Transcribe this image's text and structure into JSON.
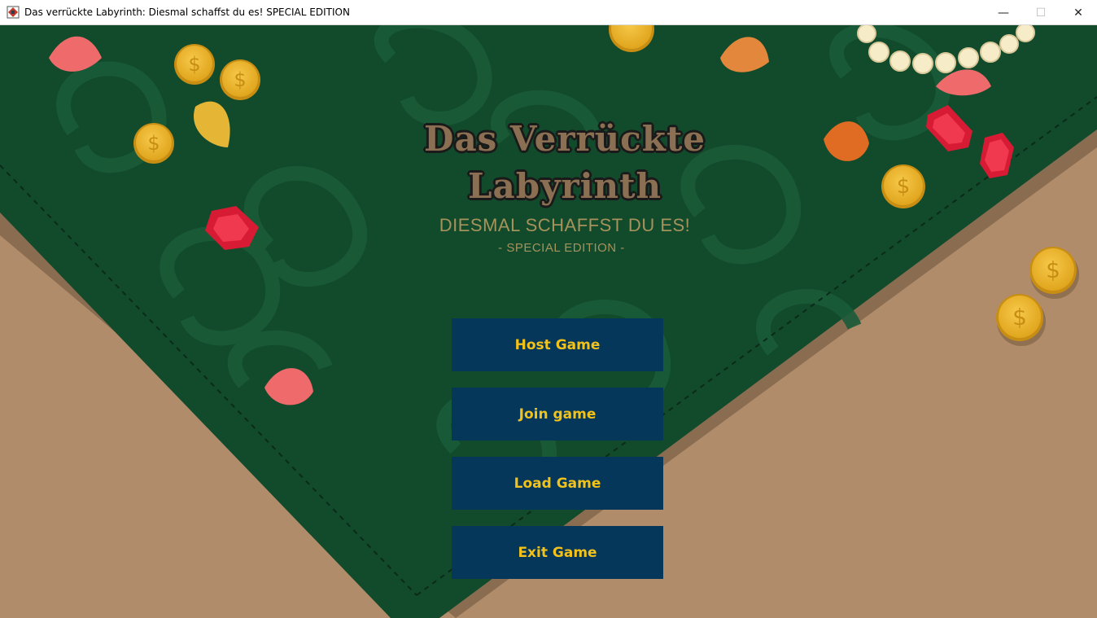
{
  "window": {
    "title": "Das verrückte Labyrinth: Diesmal schaffst du es! SPECIAL EDITION",
    "controls": {
      "minimize": "—",
      "maximize": "☐",
      "close": "✕"
    }
  },
  "logo": {
    "line1": "Das Verrückte",
    "line2": "Labyrinth"
  },
  "subtitle": "DIESMAL SCHAFFST DU ES!",
  "edition": "- SPECIAL EDITION -",
  "menu": {
    "host": "Host Game",
    "join": "Join game",
    "load": "Load Game",
    "exit": "Exit Game"
  },
  "colors": {
    "table_green": "#124a2c",
    "floor_tan": "#b08c6a",
    "button_bg": "#05375b",
    "button_text": "#f2c21a",
    "subtitle": "#a6925b"
  },
  "decorations": [
    "gold-coin-icon",
    "ruby-gem-icon",
    "flower-petal-icon",
    "pearl-necklace-icon"
  ]
}
